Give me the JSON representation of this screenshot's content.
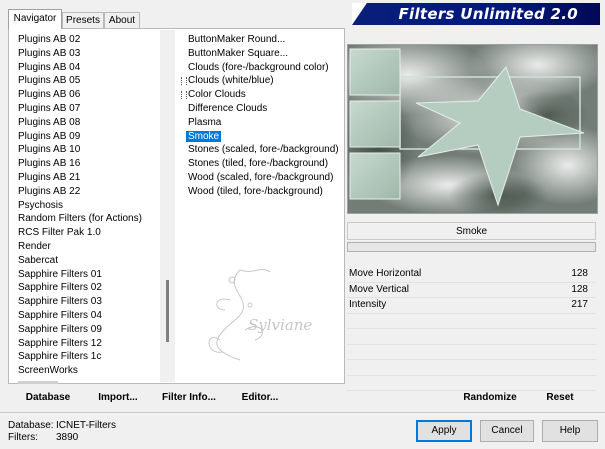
{
  "tabs": [
    "Navigator",
    "Presets",
    "About"
  ],
  "title": "Filters Unlimited 2.0",
  "categories": [
    "Plugins AB 02",
    "Plugins AB 03",
    "Plugins AB 04",
    "Plugins AB 05",
    "Plugins AB 06",
    "Plugins AB 07",
    "Plugins AB 08",
    "Plugins AB 09",
    "Plugins AB 10",
    "Plugins AB 16",
    "Plugins AB 21",
    "Plugins AB 22",
    "Psychosis",
    "Random Filters (for Actions)",
    "RCS Filter Pak 1.0",
    "Render",
    "Sabercat",
    "Sapphire Filters 01",
    "Sapphire Filters 02",
    "Sapphire Filters 03",
    "Sapphire Filters 04",
    "Sapphire Filters 09",
    "Sapphire Filters 12",
    "Sapphire Filters 1c",
    "ScreenWorks"
  ],
  "filters": [
    {
      "label": "ButtonMaker Round...",
      "sub": false,
      "selected": false
    },
    {
      "label": "ButtonMaker Square...",
      "sub": false,
      "selected": false
    },
    {
      "label": "Clouds (fore-/background color)",
      "sub": false,
      "selected": false
    },
    {
      "label": "Clouds (white/blue)",
      "sub": true,
      "selected": false
    },
    {
      "label": "Color Clouds",
      "sub": true,
      "selected": false
    },
    {
      "label": "Difference Clouds",
      "sub": false,
      "selected": false
    },
    {
      "label": "Plasma",
      "sub": false,
      "selected": false
    },
    {
      "label": "Smoke",
      "sub": false,
      "selected": true
    },
    {
      "label": "Stones (scaled, fore-/background)",
      "sub": false,
      "selected": false
    },
    {
      "label": "Stones (tiled, fore-/background)",
      "sub": false,
      "selected": false
    },
    {
      "label": "Wood (scaled, fore-/background)",
      "sub": false,
      "selected": false
    },
    {
      "label": "Wood (tiled, fore-/background)",
      "sub": false,
      "selected": false
    }
  ],
  "watermark": "Sylviane",
  "filter_name": "Smoke",
  "params": [
    {
      "label": "Move Horizontal",
      "value": "128"
    },
    {
      "label": "Move Vertical",
      "value": "128"
    },
    {
      "label": "Intensity",
      "value": "217"
    }
  ],
  "toolbar": {
    "database": "Database",
    "import": "Import...",
    "filter_info": "Filter Info...",
    "editor": "Editor...",
    "randomize": "Randomize",
    "reset": "Reset"
  },
  "footer": {
    "database_label": "Database:",
    "database_value": "ICNET-Filters",
    "filters_label": "Filters:",
    "filters_value": "3890"
  },
  "buttons": {
    "apply": "Apply",
    "cancel": "Cancel",
    "help": "Help"
  }
}
